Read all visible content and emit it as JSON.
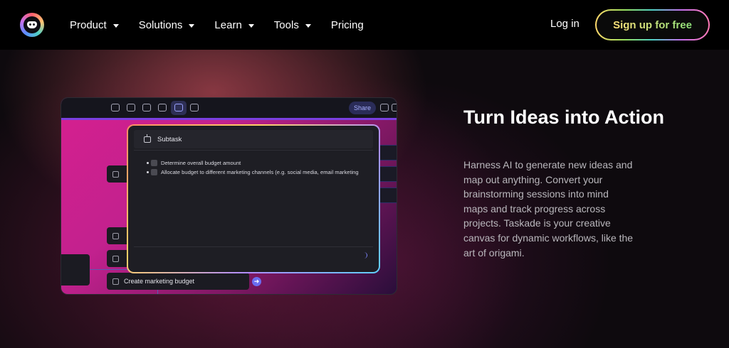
{
  "nav": {
    "items": [
      {
        "label": "Product",
        "dropdown": true
      },
      {
        "label": "Solutions",
        "dropdown": true
      },
      {
        "label": "Learn",
        "dropdown": true
      },
      {
        "label": "Tools",
        "dropdown": true
      },
      {
        "label": "Pricing",
        "dropdown": false
      }
    ],
    "login_label": "Log in",
    "signup_label": "Sign up for free"
  },
  "hero": {
    "title": "Turn Ideas into Action",
    "description": "Harness AI to generate new ideas and map out anything. Convert your brainstorming sessions into mind maps and track progress across projects. Taskade is your creative canvas for dynamic workflows, like the art of origami."
  },
  "mockup": {
    "share_label": "Share",
    "modal": {
      "title": "Subtask",
      "tasks": [
        "Determine overall budget amount",
        "Allocate budget to different marketing channels (e.g. social media, email marketing"
      ]
    },
    "node_label": "Create marketing budget"
  },
  "colors": {
    "accent": "#7b3fe0",
    "signup_gradient_start": "#ffd86b",
    "signup_gradient_end": "#ff7ab6",
    "background": "#000000"
  }
}
